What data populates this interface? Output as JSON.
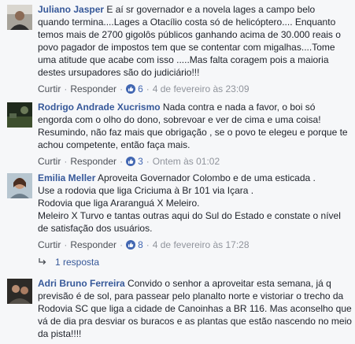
{
  "comments": [
    {
      "author": "Juliano Jasper",
      "text_first": " E aí sr governador e a novela lages a campo belo",
      "text_rest": "quando termina....Lages a Otacílio costa só de helicóptero.... Enquanto temos mais de 2700 gigolôs públicos ganhando acima de 30.000 reais o povo pagador de impostos tem que se contentar com migalhas....Tome uma atitude que acabe com isso .....Mas falta coragem pois a maioria destes ursupadores são do judiciário!!!",
      "like": "Curtir",
      "reply": "Responder",
      "likes": "6",
      "time": "4 de fevereiro às 23:09"
    },
    {
      "author": "Rodrigo Andrade Xucrismo",
      "text_first": " Nada contra e nada a favor, o boi só",
      "text_rest": "engorda com o olho do dono, sobrevoar e ver de cima e uma coisa! Resumindo, não faz mais que obrigação , se o povo te elegeu e porque te achou competente, então faça mais.",
      "like": "Curtir",
      "reply": "Responder",
      "likes": "3",
      "time": "Ontem às 01:02"
    },
    {
      "author": "Emilia Meller",
      "text_first": " Aproveita Governador Colombo e de uma esticada .",
      "text_rest": "Use a rodovia que liga Criciuma à Br 101 via Içara .\nRodovia que liga Araranguá X Meleiro.\nMeleiro X Turvo e tantas outras aqui do Sul do Estado e constate o nível de satisfação dos usuários.",
      "like": "Curtir",
      "reply": "Responder",
      "likes": "8",
      "time": "4 de fevereiro às 17:28",
      "replies_label": "1 resposta"
    },
    {
      "author": "Adri Bruno Ferreira",
      "text_first": " Convido o senhor a aproveitar esta semana, já q",
      "text_rest": "previsão é de sol, para passear pelo planalto norte e vistoriar o trecho da Rodovia SC que liga a cidade de Canoinhas a BR 116. Mas aconselho que vá de dia pra desviar os buracos e as plantas que estão nascendo no meio da pista!!!!"
    }
  ],
  "icons": {
    "like_badge": "thumbs-up-icon",
    "reply_arrow": "reply-arrow-icon"
  },
  "colors": {
    "author": "#365899",
    "like_badge": "#4267b2",
    "meta": "#90949c"
  }
}
